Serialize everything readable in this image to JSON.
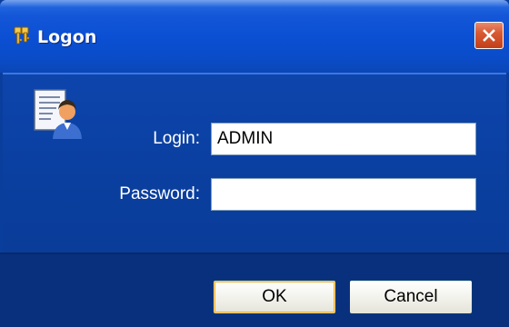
{
  "window": {
    "title": "Logon",
    "title_icon": "key-icon",
    "close_icon": "close-icon",
    "colors": {
      "titlebar": "#0b4fd4",
      "client": "#0a3e9c",
      "footer": "#08307c",
      "close_button": "#d85a32"
    }
  },
  "form": {
    "user_icon": "user-document-icon",
    "login_label": "Login:",
    "login_value": "ADMIN",
    "password_label": "Password:",
    "password_value": ""
  },
  "buttons": {
    "ok_label": "OK",
    "cancel_label": "Cancel"
  }
}
